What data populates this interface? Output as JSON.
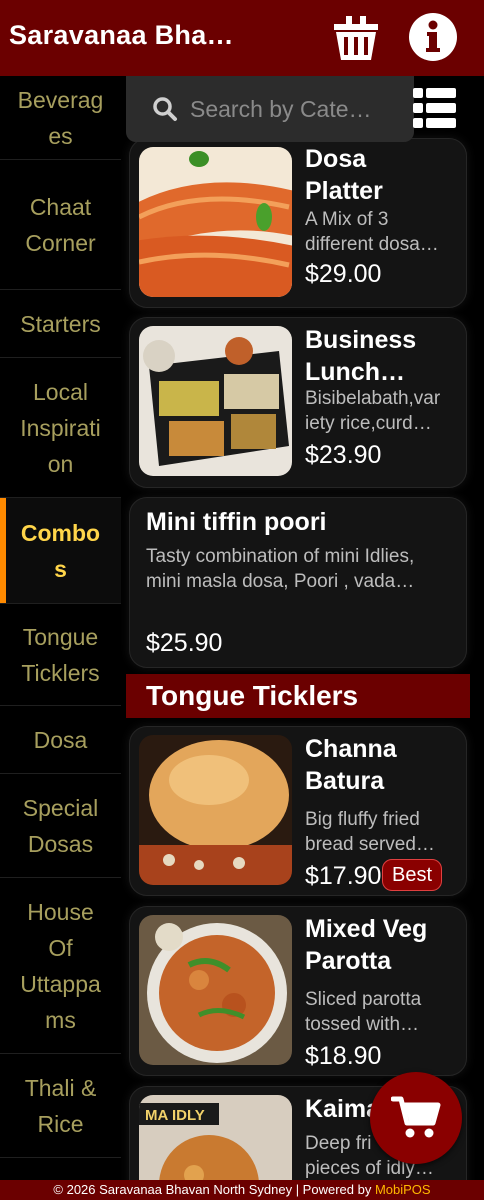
{
  "header": {
    "title": "Saravanaa Bha…",
    "basket_icon": "basket-icon",
    "info_icon": "info-icon"
  },
  "search": {
    "placeholder": "Search by Cate…",
    "icon": "search-icon"
  },
  "sidebar": {
    "items": [
      {
        "label": "Beverages",
        "lines": [
          "Beverag",
          "es"
        ]
      },
      {
        "label": "Chaat Corner",
        "lines": [
          "Chaat",
          "Corner"
        ]
      },
      {
        "label": "Starters",
        "lines": [
          "Starters"
        ]
      },
      {
        "label": "Local Inspiration",
        "lines": [
          "Local",
          "Inspirati",
          "on"
        ]
      },
      {
        "label": "Combos",
        "lines": [
          "Combo",
          "s"
        ],
        "active": true
      },
      {
        "label": "Tongue Ticklers",
        "lines": [
          "Tongue",
          "Ticklers"
        ]
      },
      {
        "label": "Dosa",
        "lines": [
          "Dosa"
        ]
      },
      {
        "label": "Special Dosas",
        "lines": [
          "Special",
          "Dosas"
        ]
      },
      {
        "label": "House Of Uttappams",
        "lines": [
          "House",
          "Of",
          "Uttappa",
          "ms"
        ]
      },
      {
        "label": "Thali & Rice",
        "lines": [
          "Thali &",
          "Rice"
        ]
      }
    ]
  },
  "items": {
    "dosa_platter": {
      "name": "Dosa Platter",
      "name_lines": [
        "Dosa",
        "Platter"
      ],
      "desc_lines": [
        "A Mix of 3",
        "different dosa…"
      ],
      "price": "$29.00"
    },
    "business_lunch": {
      "name_lines": [
        "Business",
        "Lunch…"
      ],
      "desc_lines": [
        "Bisibelabath,var",
        "iety rice,curd…"
      ],
      "price": "$23.90"
    },
    "mini_tiffin": {
      "name": "Mini tiffin poori",
      "desc_lines": [
        "Tasty combination of mini Idlies,",
        "mini masla dosa, Poori , vada…"
      ],
      "price": "$25.90"
    },
    "channa_batura": {
      "name_lines": [
        "Channa",
        "Batura"
      ],
      "desc_lines": [
        "Big fluffy fried",
        "bread served…"
      ],
      "price": "$17.90",
      "badge": "Best"
    },
    "mixed_veg_parotta": {
      "name_lines": [
        "Mixed Veg",
        "Parotta"
      ],
      "desc_lines": [
        "Sliced parotta",
        "tossed with…"
      ],
      "price": "$18.90"
    },
    "kaima": {
      "name_lines": [
        "Kaima"
      ],
      "desc_lines": [
        "Deep fri",
        "pieces of idly…"
      ],
      "thumb_text": "MA IDLY"
    }
  },
  "section": {
    "title": "Tongue Ticklers"
  },
  "cart": {
    "icon": "cart-icon"
  },
  "footer": {
    "text": "© 2026 Saravanaa Bhavan North Sydney | Powered by ",
    "brand": "MobiPOS"
  },
  "colors": {
    "header": "#6b0000",
    "accent": "#ff8a00",
    "active_text": "#ffd54a",
    "category_text": "#a79f5e",
    "badge": "#8a0000",
    "brand": "#ffb800"
  }
}
